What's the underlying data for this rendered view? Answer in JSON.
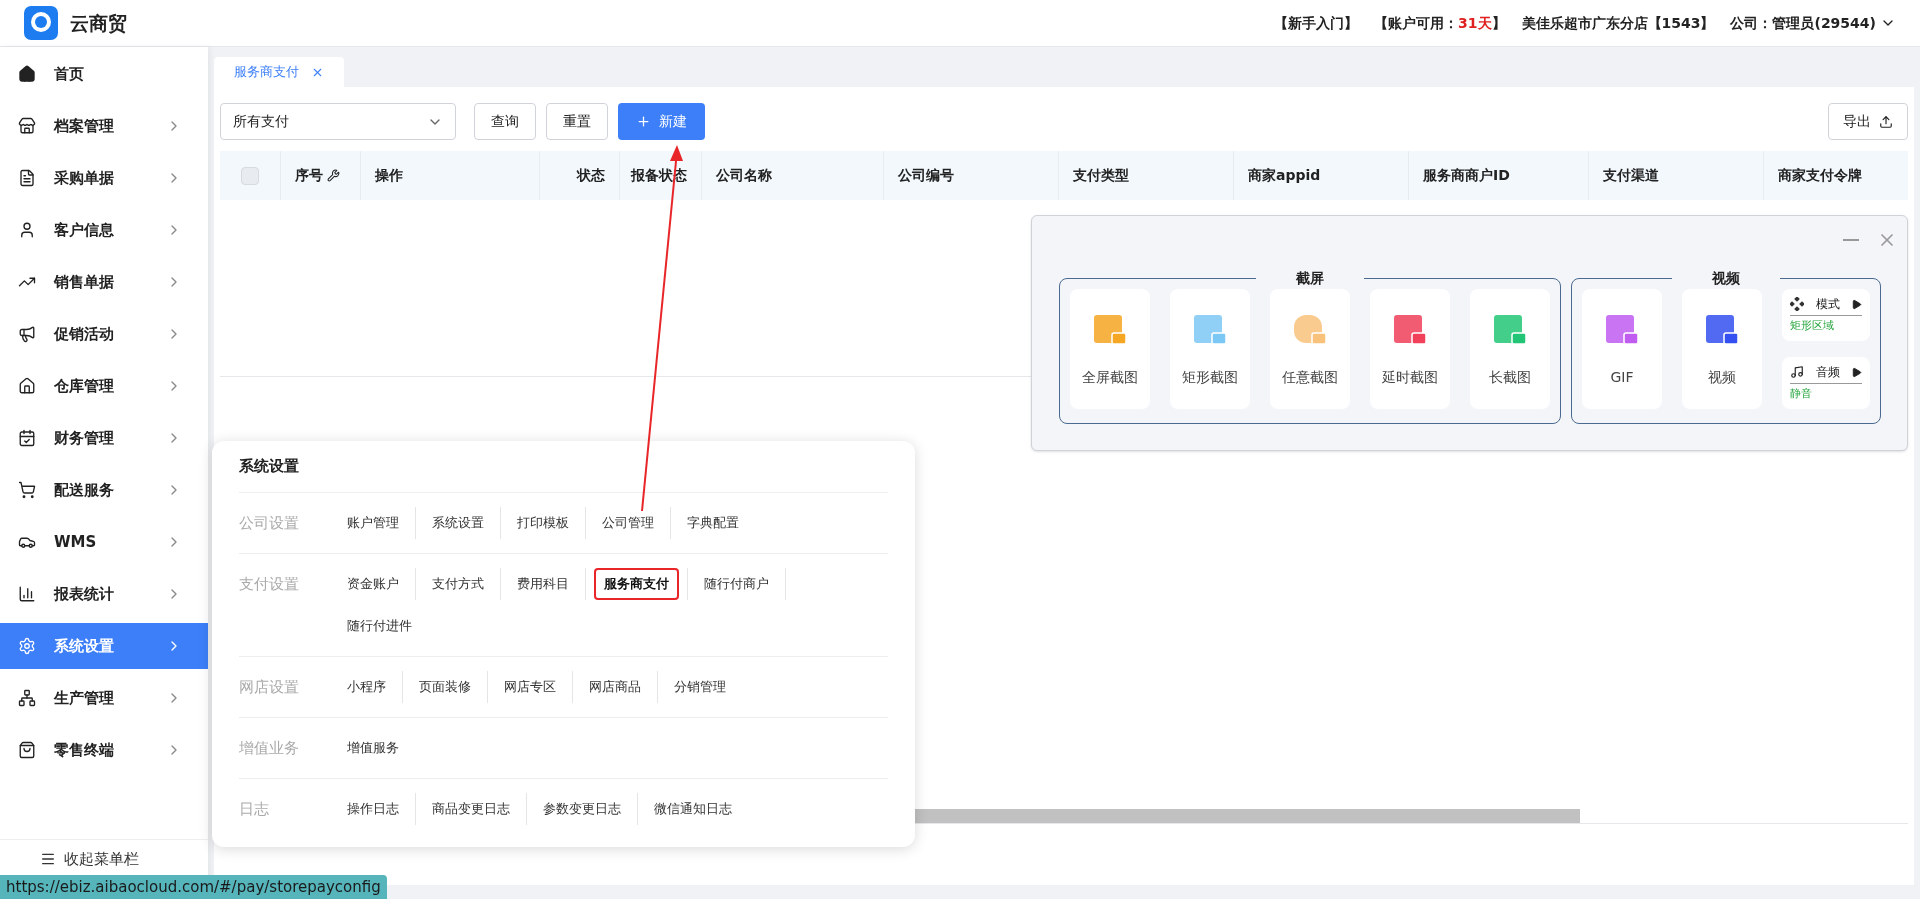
{
  "header": {
    "app_name": "云商贸",
    "guide_link": "【新手入门】",
    "account_prefix": "【账户可用：",
    "account_days": "31天",
    "account_suffix": "】",
    "store": "美佳乐超市广东分店【1543】",
    "company": "公司：管理员(29544)"
  },
  "sidebar": {
    "items": [
      {
        "label": "首页",
        "selected": false,
        "has_children": false
      },
      {
        "label": "档案管理",
        "selected": false,
        "has_children": true
      },
      {
        "label": "采购单据",
        "selected": false,
        "has_children": true
      },
      {
        "label": "客户信息",
        "selected": false,
        "has_children": true
      },
      {
        "label": "销售单据",
        "selected": false,
        "has_children": true
      },
      {
        "label": "促销活动",
        "selected": false,
        "has_children": true
      },
      {
        "label": "仓库管理",
        "selected": false,
        "has_children": true
      },
      {
        "label": "财务管理",
        "selected": false,
        "has_children": true
      },
      {
        "label": "配送服务",
        "selected": false,
        "has_children": true
      },
      {
        "label": "WMS",
        "selected": false,
        "has_children": true
      },
      {
        "label": "报表统计",
        "selected": false,
        "has_children": true
      },
      {
        "label": "系统设置",
        "selected": true,
        "has_children": true
      },
      {
        "label": "生产管理",
        "selected": false,
        "has_children": true
      },
      {
        "label": "零售终端",
        "selected": false,
        "has_children": true
      }
    ],
    "collapse": "收起菜单栏"
  },
  "tabs": [
    {
      "label": "服务商支付",
      "selected": true
    }
  ],
  "toolbar": {
    "filter": "所有支付",
    "query": "查询",
    "reset": "重置",
    "new": "新建",
    "export": "导出"
  },
  "table": {
    "select_all_checked": false,
    "columns": [
      "序号",
      "操作",
      "状态",
      "报备状态",
      "公司名称",
      "公司编号",
      "支付类型",
      "商家appid",
      "服务商商户ID",
      "支付渠道",
      "商家支付令牌"
    ]
  },
  "status_url": "https://ebiz.aibaocloud.com/#/pay/storepayconfig",
  "menu_popup": {
    "title": "系统设置",
    "groups": [
      {
        "label": "公司设置",
        "items": [
          {
            "label": "账户管理",
            "selected": false
          },
          {
            "label": "系统设置",
            "selected": false
          },
          {
            "label": "打印模板",
            "selected": false
          },
          {
            "label": "公司管理",
            "selected": false
          },
          {
            "label": "字典配置",
            "selected": false
          }
        ]
      },
      {
        "label": "支付设置",
        "items": [
          {
            "label": "资金账户",
            "selected": false
          },
          {
            "label": "支付方式",
            "selected": false
          },
          {
            "label": "费用科目",
            "selected": false
          },
          {
            "label": "服务商支付",
            "selected": true
          },
          {
            "label": "随行付商户",
            "selected": false
          },
          {
            "label": "随行付进件",
            "selected": false
          }
        ]
      },
      {
        "label": "网店设置",
        "items": [
          {
            "label": "小程序",
            "selected": false
          },
          {
            "label": "页面装修",
            "selected": false
          },
          {
            "label": "网店专区",
            "selected": false
          },
          {
            "label": "网店商品",
            "selected": false
          },
          {
            "label": "分销管理",
            "selected": false
          }
        ]
      },
      {
        "label": "增值业务",
        "items": [
          {
            "label": "增值服务",
            "selected": false
          }
        ]
      },
      {
        "label": "日志",
        "items": [
          {
            "label": "操作日志",
            "selected": false
          },
          {
            "label": "商品变更日志",
            "selected": false
          },
          {
            "label": "参数变更日志",
            "selected": false
          },
          {
            "label": "微信通知日志",
            "selected": false
          }
        ]
      }
    ]
  },
  "capture_tool": {
    "sections": [
      {
        "title": "截屏",
        "tools": [
          "全屏截图",
          "矩形截图",
          "任意截图",
          "延时截图",
          "长截图"
        ]
      },
      {
        "title": "视频",
        "tools": [
          "GIF",
          "视频"
        ],
        "options": [
          {
            "label": "模式",
            "value": "矩形区域"
          },
          {
            "label": "音频",
            "value": "静音"
          }
        ]
      }
    ]
  }
}
